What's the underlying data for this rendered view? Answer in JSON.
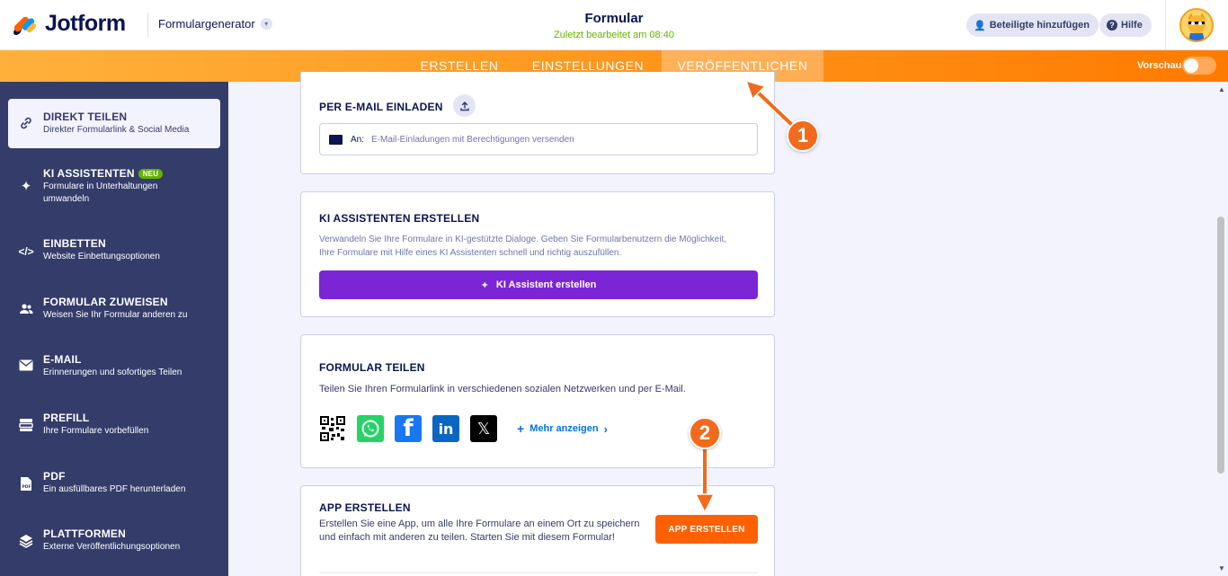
{
  "header": {
    "brand": "Jotform",
    "product_switch": "Formulargenerator",
    "form_title": "Formular",
    "last_edited": "Zuletzt bearbeitet am 08:40",
    "add_participants": "Beteiligte hinzufügen",
    "help": "Hilfe"
  },
  "nav": {
    "tabs": [
      "ERSTELLEN",
      "EINSTELLUNGEN",
      "VERÖFFENTLICHEN"
    ],
    "active_tab": "VERÖFFENTLICHEN",
    "preview_label": "Vorschau",
    "preview_on": false
  },
  "sidebar": {
    "items": [
      {
        "title": "DIREKT TEILEN",
        "desc": "Direkter Formularlink & Social Media",
        "icon": "link-icon",
        "active": true
      },
      {
        "title": "KI ASSISTENTEN",
        "badge": "NEU",
        "desc": "Formulare in Unterhaltungen umwandeln",
        "icon": "sparkle-icon",
        "active": false
      },
      {
        "title": "EINBETTEN",
        "desc": "Website Einbettungsoptionen",
        "icon": "code-icon",
        "active": false
      },
      {
        "title": "FORMULAR ZUWEISEN",
        "desc": "Weisen Sie Ihr Formular anderen zu",
        "icon": "users-icon",
        "active": false
      },
      {
        "title": "E-MAIL",
        "desc": "Erinnerungen und sofortiges Teilen",
        "icon": "mail-icon",
        "active": false
      },
      {
        "title": "PREFILL",
        "desc": "Ihre Formulare vorbefüllen",
        "icon": "prefill-icon",
        "active": false
      },
      {
        "title": "PDF",
        "desc": "Ein ausfüllbares PDF herunterladen",
        "icon": "pdf-icon",
        "active": false
      },
      {
        "title": "PLATTFORMEN",
        "desc": "Externe Veröffentlichungsoptionen",
        "icon": "layers-icon",
        "active": false
      }
    ]
  },
  "cards": {
    "email_invite": {
      "title": "PER E-MAIL EINLADEN",
      "to_label": "An:",
      "placeholder": "E-Mail-Einladungen mit Berechtigungen versenden"
    },
    "ki": {
      "title": "KI ASSISTENTEN ERSTELLEN",
      "text": "Verwandeln Sie Ihre Formulare in KI-gestützte Dialoge. Geben Sie Formularbenutzern die Möglichkeit, Ihre Formulare mit Hilfe eines KI Assistenten schnell und richtig auszufüllen.",
      "button": "KI Assistent erstellen"
    },
    "share": {
      "title": "FORMULAR TEILEN",
      "text": "Teilen Sie Ihren Formularlink in verschiedenen sozialen Netzwerken und per E-Mail.",
      "more": "Mehr anzeigen",
      "networks": [
        "qr-code-icon",
        "whatsapp-icon",
        "facebook-icon",
        "linkedin-icon",
        "x-icon"
      ]
    },
    "app": {
      "title": "APP ERSTELLEN",
      "text": "Erstellen Sie eine App, um alle Ihre Formulare an einem Ort zu speichern und einfach mit anderen zu teilen. Starten Sie mit diesem Formular!",
      "button": "APP ERSTELLEN"
    }
  },
  "annotations": [
    {
      "number": "1",
      "target": "VERÖFFENTLICHEN"
    },
    {
      "number": "2",
      "target": "APP ERSTELLEN"
    }
  ],
  "colors": {
    "brand_orange": "#ff6100",
    "sidebar_bg": "#343c6a",
    "ki_purple": "#7b25d6",
    "annotation": "#f26a1b"
  }
}
